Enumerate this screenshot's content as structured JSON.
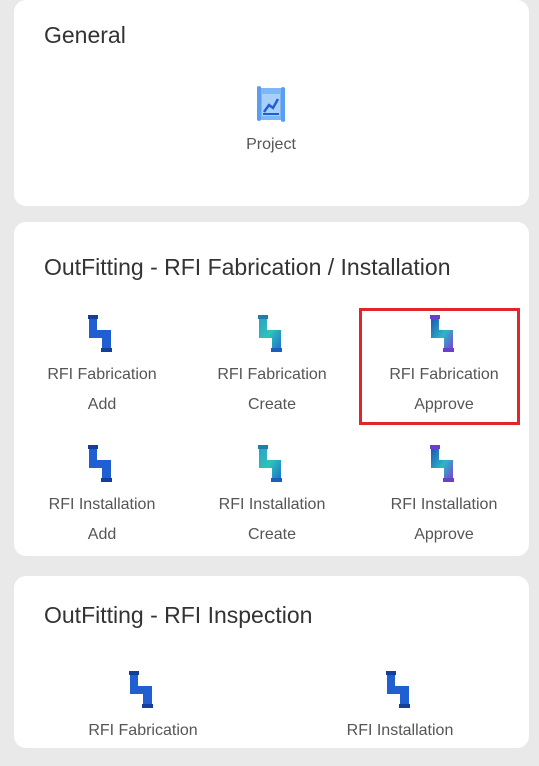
{
  "colors": {
    "background": "#e9e9e9",
    "card": "#ffffff",
    "highlight": "#e0252b",
    "pipe_blue": "#1f5fd1",
    "pipe_teal": "#26b5c2",
    "pipe_purple": "#6a3fd0"
  },
  "sections": {
    "general": {
      "title": "General",
      "items": [
        {
          "label": "Project",
          "icon": "project-chart-icon"
        }
      ]
    },
    "outfitting_rfi": {
      "title": "OutFitting - RFI Fabrication / Installation",
      "items": [
        {
          "line1": "RFI Fabrication",
          "line2": "Add",
          "icon": "pipe-blue-icon"
        },
        {
          "line1": "RFI Fabrication",
          "line2": "Create",
          "icon": "pipe-teal-icon"
        },
        {
          "line1": "RFI Fabrication",
          "line2": "Approve",
          "icon": "pipe-purple-icon"
        },
        {
          "line1": "RFI Installation",
          "line2": "Add",
          "icon": "pipe-blue-icon"
        },
        {
          "line1": "RFI Installation",
          "line2": "Create",
          "icon": "pipe-teal-icon"
        },
        {
          "line1": "RFI Installation",
          "line2": "Approve",
          "icon": "pipe-purple-icon"
        }
      ]
    },
    "inspection": {
      "title": "OutFitting - RFI Inspection",
      "items": [
        {
          "label": "RFI Fabrication",
          "icon": "pipe-blue-icon"
        },
        {
          "label": "RFI Installation",
          "icon": "pipe-blue-icon"
        }
      ]
    }
  }
}
